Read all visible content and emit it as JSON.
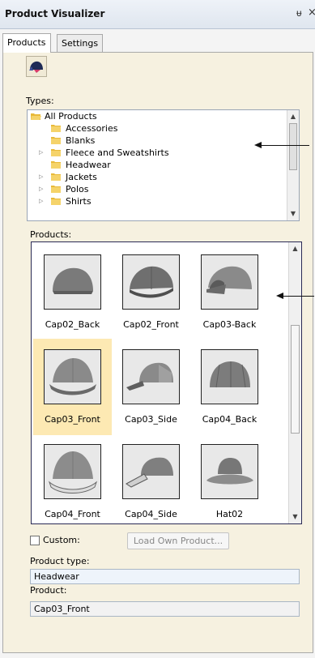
{
  "window": {
    "title": "Product Visualizer",
    "pin_glyph": "ᵾ",
    "close_glyph": "×"
  },
  "tabs": [
    {
      "label": "Products",
      "active": true
    },
    {
      "label": "Settings",
      "active": false
    }
  ],
  "toolbar": {
    "icon": "cap-visualizer-icon"
  },
  "types": {
    "label": "Types:",
    "items": [
      {
        "label": "All Products",
        "expandable": false,
        "level": 0
      },
      {
        "label": "Accessories",
        "expandable": false,
        "level": 1
      },
      {
        "label": "Blanks",
        "expandable": false,
        "level": 1
      },
      {
        "label": "Fleece and Sweatshirts",
        "expandable": true,
        "level": 1
      },
      {
        "label": "Headwear",
        "expandable": false,
        "level": 1
      },
      {
        "label": "Jackets",
        "expandable": true,
        "level": 1
      },
      {
        "label": "Polos",
        "expandable": true,
        "level": 1
      },
      {
        "label": "Shirts",
        "expandable": true,
        "level": 1
      }
    ]
  },
  "products": {
    "label": "Products:",
    "items": [
      {
        "name": "Cap02_Back",
        "selected": false
      },
      {
        "name": "Cap02_Front",
        "selected": false
      },
      {
        "name": "Cap03-Back",
        "selected": false
      },
      {
        "name": "Cap03_Front",
        "selected": true
      },
      {
        "name": "Cap03_Side",
        "selected": false
      },
      {
        "name": "Cap04_Back",
        "selected": false
      },
      {
        "name": "Cap04_Front",
        "selected": false
      },
      {
        "name": "Cap04_Side",
        "selected": false
      },
      {
        "name": "Hat02",
        "selected": false
      }
    ]
  },
  "custom": {
    "label": "Custom:",
    "checked": false,
    "button_label": "Load Own Product..."
  },
  "product_type": {
    "label": "Product type:",
    "value": "Headwear"
  },
  "product": {
    "label": "Product:",
    "value": "Cap03_Front"
  },
  "colors": {
    "selection": "#fde9b3",
    "folder": "#e8b93a",
    "panel": "#f6f1e0"
  }
}
